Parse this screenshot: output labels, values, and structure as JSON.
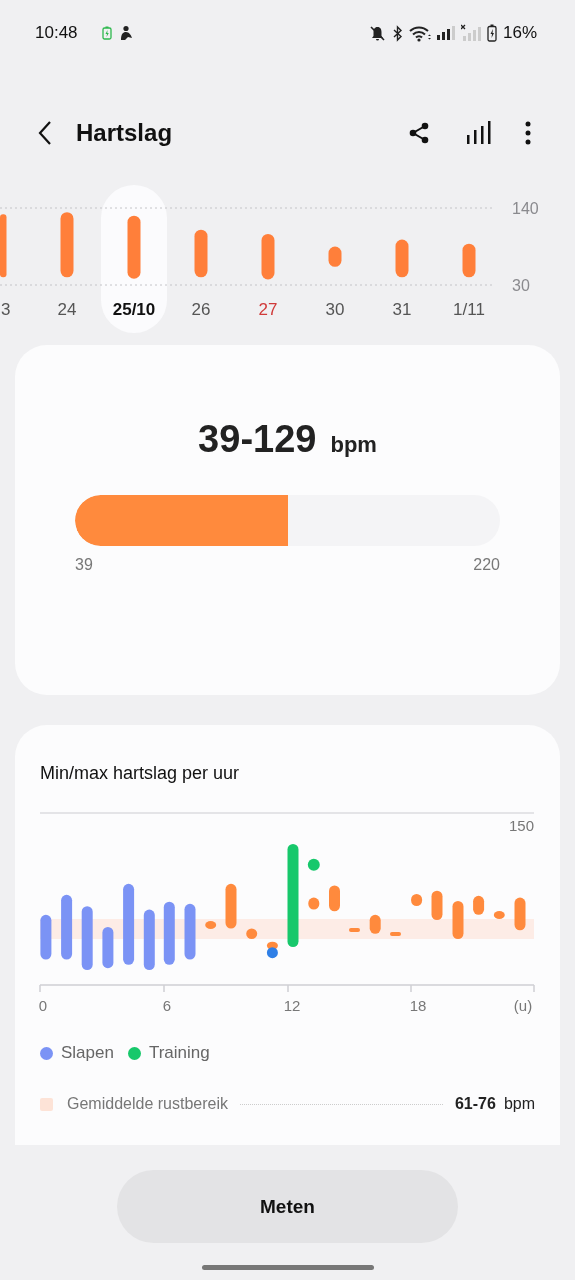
{
  "status_bar": {
    "time": "10:48",
    "battery": "16%"
  },
  "header": {
    "title": "Hartslag"
  },
  "daily_chart": {
    "y_labels": [
      "140",
      "30"
    ],
    "days": [
      {
        "label": "3",
        "selected": false,
        "color": "#555555"
      },
      {
        "label": "24",
        "selected": false,
        "color": "#555555"
      },
      {
        "label": "25/10",
        "selected": true,
        "color": "#111111"
      },
      {
        "label": "26",
        "selected": false,
        "color": "#555555"
      },
      {
        "label": "27",
        "selected": false,
        "color": "#d03a3a"
      },
      {
        "label": "30",
        "selected": false,
        "color": "#555555"
      },
      {
        "label": "31",
        "selected": false,
        "color": "#555555"
      },
      {
        "label": "1/11",
        "selected": false,
        "color": "#555555"
      }
    ]
  },
  "summary": {
    "range": "39-129",
    "unit": "bpm",
    "level": 0.5,
    "min_label": "39",
    "max_label": "220"
  },
  "hourly": {
    "title": "Min/max hartslag per uur",
    "y_label": "150",
    "x_labels": [
      "0",
      "6",
      "12",
      "18",
      "(u)"
    ],
    "legend": [
      {
        "label": "Slapen",
        "color": "#7b93f5"
      },
      {
        "label": "Training",
        "color": "#17c86b"
      }
    ],
    "resting": {
      "label": "Gemiddelde rustbereik",
      "value": "61-76",
      "unit": "bpm"
    }
  },
  "button": "Meten"
}
